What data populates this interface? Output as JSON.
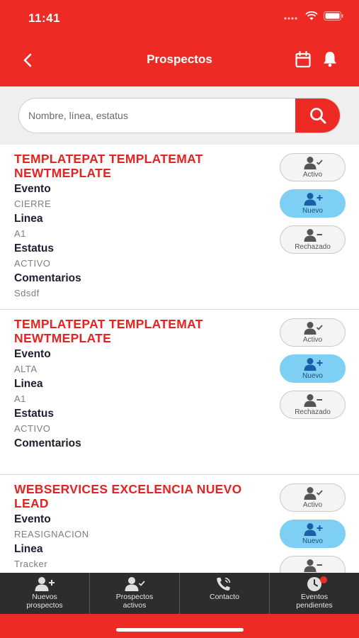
{
  "status": {
    "time": "11:41"
  },
  "header": {
    "title": "Prospectos",
    "back_icon": "back-arrow-icon",
    "calendar_icon": "calendar-icon",
    "bell_icon": "bell-icon"
  },
  "search": {
    "placeholder": "Nombre, línea, estatus",
    "value": "",
    "button_icon": "search-icon"
  },
  "labels": {
    "evento": "Evento",
    "linea": "Linea",
    "estatus": "Estatus",
    "comentarios": "Comentarios"
  },
  "actions": {
    "activo": "Activo",
    "nuevo": "Nuevo",
    "rechazado": "Rechazado"
  },
  "cards": [
    {
      "title": "TEMPLATEPAT TEMPLATEMAT NEWTMEPLATE",
      "evento": "CIERRE",
      "linea": "A1",
      "estatus": "ACTIVO",
      "comentarios": "Sdsdf"
    },
    {
      "title": "TEMPLATEPAT TEMPLATEMAT NEWTMEPLATE",
      "evento": "ALTA",
      "linea": "A1",
      "estatus": "ACTIVO",
      "comentarios": ""
    },
    {
      "title": "WEBSERVICES EXCELENCIA NUEVO LEAD",
      "evento": "REASIGNACION",
      "linea": "Tracker",
      "estatus": "",
      "comentarios": ""
    }
  ],
  "tabs": [
    {
      "label": "Nuevos\nprospectos",
      "icon": "add-user-icon"
    },
    {
      "label": "Prospectos\nactivos",
      "icon": "user-check-icon"
    },
    {
      "label": "Contacto",
      "icon": "phone-icon"
    },
    {
      "label": "Eventos\npendientes",
      "icon": "clock-icon"
    }
  ],
  "colors": {
    "brand_red": "#ee2a24",
    "title_red": "#e52320",
    "nuevo_blue": "#7dd0f3",
    "tabbar": "#2d2d2d"
  }
}
